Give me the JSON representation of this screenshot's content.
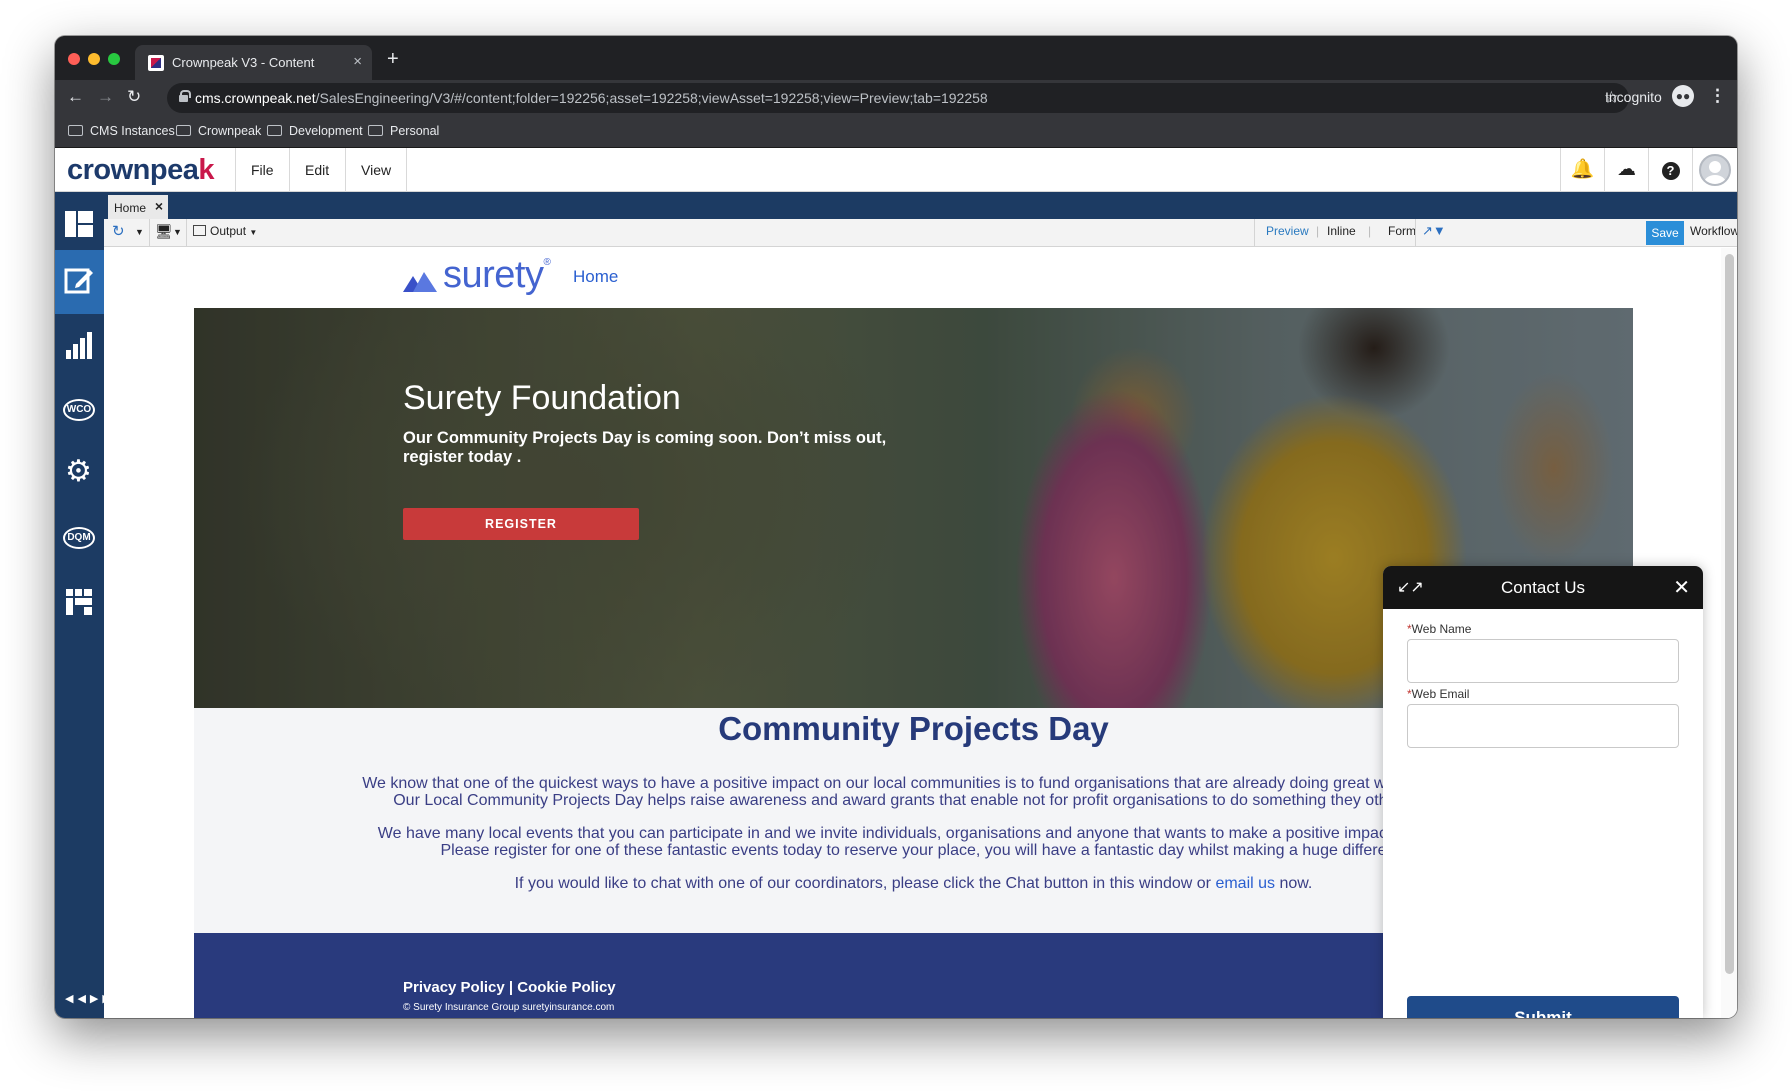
{
  "browser": {
    "tab_title": "Crownpeak V3 - Content",
    "tab_close": "×",
    "new_tab": "+",
    "url_host": "cms.crownpeak.net",
    "url_path": "/SalesEngineering/V3/#/content;folder=192256;asset=192258;viewAsset=192258;view=Preview;tab=192258",
    "incognito_label": "Incognito",
    "bookmarks": [
      "CMS Instances",
      "Crownpeak",
      "Development",
      "Personal"
    ]
  },
  "app": {
    "logo_main": "crownpea",
    "logo_accent": "k",
    "menu": [
      "File",
      "Edit",
      "View"
    ],
    "rail_labels": {
      "wco": "WCO",
      "dqm": "DQM"
    },
    "home_tab": "Home",
    "home_tab_close": "×",
    "toolbar": {
      "output_label": "Output",
      "preview_label": "Preview",
      "inline_label": "Inline",
      "form_label": "Form",
      "save_label": "Save",
      "workflow_label": "Workflow"
    }
  },
  "site": {
    "logo_text": "surety",
    "logo_mark": "®",
    "nav_home": "Home",
    "hero": {
      "title": "Surety Foundation",
      "text": "Our Community Projects Day is coming soon.  Don’t miss out, register today .",
      "register_label": "REGISTER"
    },
    "section_title": "Community Projects Day",
    "para1_line1": "We know that one of the quickest ways to have a positive impact on our local communities is to fund organisations that are already doing great work and hel",
    "para1_line2": "Our Local Community Projects Day helps raise awareness and award grants that enable not for profit organisations to do something they otherwise",
    "para2_line1": "We have many local events that you can participate in and we invite individuals, organisations and anyone that wants to make a positive impact to atten",
    "para2_line2": "Please register for one of these fantastic events today to reserve your place, you will have a fantastic day whilst making a huge differe",
    "para3_before": "If you would like to chat with one of our coordinators, please click the Chat button in this window or ",
    "para3_link": "email us",
    "para3_after": " now.",
    "footer_links": "Privacy Policy | Cookie Policy",
    "footer_copy": "© Surety Insurance Group suretyinsurance.com"
  },
  "contact": {
    "title": "Contact Us",
    "required_mark": "*",
    "name_label": "Web Name",
    "email_label": "Web Email",
    "name_value": "",
    "email_value": "",
    "submit_label": "Submit"
  },
  "colors": {
    "cms_navy": "#1c3b63",
    "cms_active": "#2a6bb0",
    "brand_pink": "#c9184a",
    "site_navy": "#293a7d",
    "register_red": "#c83a3a",
    "submit_blue": "#1f4b8a"
  },
  "icons": [
    "back-arrow-icon",
    "forward-arrow-icon",
    "reload-icon",
    "lock-icon",
    "star-icon",
    "incognito-icon",
    "kebab-menu-icon",
    "folder-icon",
    "bell-icon",
    "cloud-upload-icon",
    "help-icon",
    "avatar-icon",
    "dashboard-icon",
    "edit-icon",
    "analytics-icon",
    "wco-icon",
    "settings-icon",
    "dqm-icon",
    "apps-icon",
    "refresh-icon",
    "device-icon",
    "layout-icon",
    "external-link-icon",
    "gear-icon",
    "minimize-icon",
    "close-icon"
  ]
}
